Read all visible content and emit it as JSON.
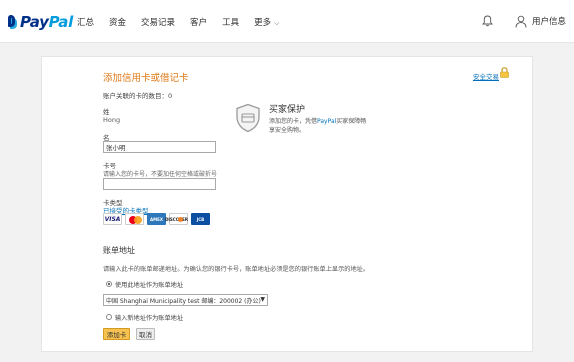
{
  "header": {
    "logo": {
      "pay": "Pay",
      "pal": "Pal"
    },
    "nav": [
      {
        "label": "汇总"
      },
      {
        "label": "资金"
      },
      {
        "label": "交易记录"
      },
      {
        "label": "客户"
      },
      {
        "label": "工具"
      },
      {
        "label": "更多"
      }
    ],
    "more_chevron": "⌵",
    "user_label": "用户信息",
    "icons": {
      "bell": "bell-icon",
      "user": "user-icon"
    }
  },
  "form": {
    "title": "添加信用卡或借记卡",
    "secure_link": "安全交易",
    "card_count": "账户关联的卡的数目：0",
    "last_name_label": "姓",
    "last_name_value": "Hong",
    "first_name_label": "名",
    "first_name_value": "张小明",
    "card_number_label": "卡号",
    "card_number_hint": "请输入您的卡号，不要加任何空格或破折号",
    "card_number_value": "",
    "card_type_label": "卡类型",
    "card_type_link": "已接受的卡类型",
    "card_brands": [
      "VISA",
      "MasterCard",
      "AMEX",
      "DISCOVER",
      "JCB"
    ]
  },
  "buyer_protection": {
    "title": "买家保护",
    "text_before": "添加您的卡，凭借",
    "brand": "PayPal",
    "text_after": "买家保障畅享安全购物。"
  },
  "billing": {
    "title": "账单地址",
    "description": "请输入此卡的账单邮递地址。为确认您的银行卡号，账单地址必须是您的银行账单上显示的地址。",
    "option_existing": "使用此地址作为账单地址",
    "selected_address": "中国 Shanghai Municipality test 邮编：200002 (办公)",
    "option_new": "输入新地址作为账单地址",
    "select_arrow": "▼"
  },
  "buttons": {
    "add_card": "添加卡",
    "cancel": "取消"
  },
  "colors": {
    "title_orange": "#e07a18",
    "link_blue": "#0070ba",
    "paypal_dark": "#003087",
    "paypal_light": "#009cde",
    "button_yellow": "#f7c24f"
  }
}
